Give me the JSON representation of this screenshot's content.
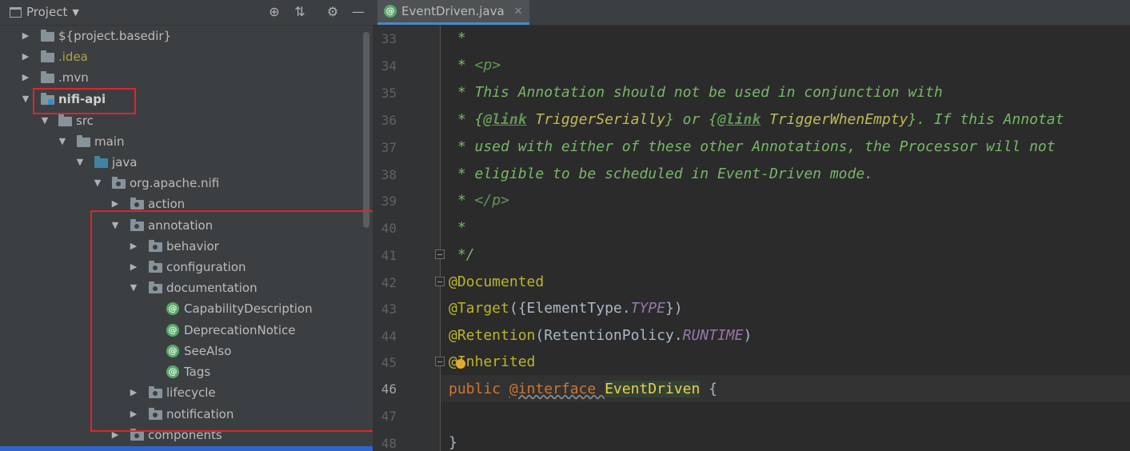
{
  "project_panel": {
    "title": "Project",
    "icons": [
      "target-icon",
      "collapse-all-icon",
      "gear-icon",
      "minimize-icon"
    ]
  },
  "tree": [
    {
      "label": "${project.basedir}",
      "icon": "folder"
    },
    {
      "label": ".idea",
      "icon": "folder"
    },
    {
      "label": ".mvn",
      "icon": "folder"
    },
    {
      "label": "nifi-api",
      "icon": "module-folder"
    },
    {
      "label": "src",
      "icon": "folder"
    },
    {
      "label": "main",
      "icon": "folder"
    },
    {
      "label": "java",
      "icon": "source-folder"
    },
    {
      "label": "org.apache.nifi",
      "icon": "package"
    },
    {
      "label": "action",
      "icon": "package"
    },
    {
      "label": "annotation",
      "icon": "package"
    },
    {
      "label": "behavior",
      "icon": "package"
    },
    {
      "label": "configuration",
      "icon": "package"
    },
    {
      "label": "documentation",
      "icon": "package"
    },
    {
      "label": "CapabilityDescription",
      "icon": "annotation"
    },
    {
      "label": "DeprecationNotice",
      "icon": "annotation"
    },
    {
      "label": "SeeAlso",
      "icon": "annotation"
    },
    {
      "label": "Tags",
      "icon": "annotation"
    },
    {
      "label": "lifecycle",
      "icon": "package"
    },
    {
      "label": "notification",
      "icon": "package"
    },
    {
      "label": "components",
      "icon": "package"
    }
  ],
  "editor": {
    "tab_label": "EventDriven.java",
    "tab_icon": "@",
    "current_line": 46,
    "line_numbers": [
      "33",
      "34",
      "35",
      "36",
      "37",
      "38",
      "39",
      "40",
      "41",
      "42",
      "43",
      "44",
      "45",
      "46",
      "47",
      "48"
    ],
    "code": {
      "l33": " *",
      "l34_star": " * ",
      "l34_p": "<p>",
      "l35": " * This Annotation should not be used in conjunction with",
      "l36_a": " * {",
      "l36_link1": "@link",
      "l36_ref1": " TriggerSerially",
      "l36_b": "} or {",
      "l36_link2": "@link",
      "l36_ref2": " TriggerWhenEmpty",
      "l36_c": "}. If this Annotat",
      "l37": " * used with either of these other Annotations, the Processor will not",
      "l38": " * eligible to be scheduled in Event-Driven mode.",
      "l39_star": " * ",
      "l39_p": "</p>",
      "l40": " *",
      "l41": " */",
      "l42": "@Documented",
      "l43_ann": "@Target",
      "l43_a": "({ElementType.",
      "l43_c": "TYPE",
      "l43_b": "})",
      "l44_ann": "@Retention",
      "l44_a": "(RetentionPolicy.",
      "l44_c": "RUNTIME",
      "l44_b": ")",
      "l45": "@Inherited",
      "l46_kw": "public ",
      "l46_iface": "@interface ",
      "l46_name": "EventDriven",
      "l46_brace": " {",
      "l48": "}"
    }
  },
  "colors": {
    "annotation_box": "#e2232d",
    "comment": "#629755",
    "keyword": "#cc7832"
  }
}
